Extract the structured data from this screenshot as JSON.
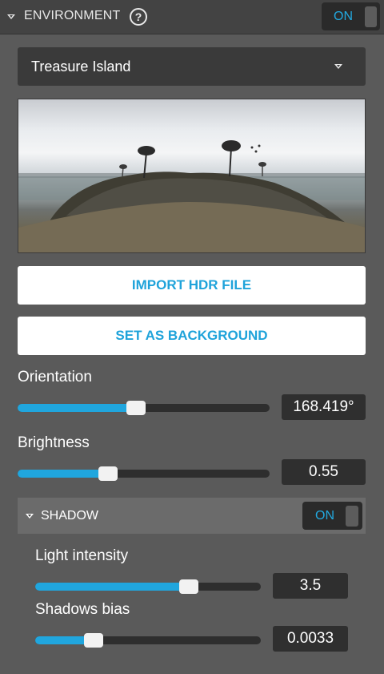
{
  "header": {
    "title": "ENVIRONMENT",
    "help_glyph": "?",
    "toggle_label": "ON"
  },
  "environment": {
    "selected": "Treasure Island",
    "import_label": "IMPORT HDR FILE",
    "background_label": "SET AS BACKGROUND"
  },
  "orientation": {
    "label": "Orientation",
    "value": "168.419°",
    "fraction": 0.47
  },
  "brightness": {
    "label": "Brightness",
    "value": "0.55",
    "fraction": 0.36
  },
  "shadow": {
    "title": "SHADOW",
    "toggle_label": "ON",
    "light_intensity": {
      "label": "Light intensity",
      "value": "3.5",
      "fraction": 0.68
    },
    "shadows_bias": {
      "label": "Shadows bias",
      "value": "0.0033",
      "fraction": 0.26
    }
  },
  "colors": {
    "accent": "#20a6de",
    "panel": "#5a5a5a",
    "header": "#434343",
    "button_text": "#1fa3da"
  },
  "icons": [
    "chevron-down-icon",
    "help-icon"
  ]
}
